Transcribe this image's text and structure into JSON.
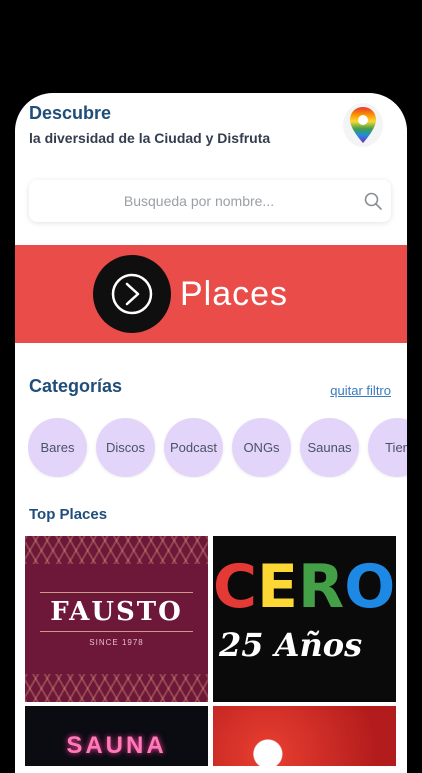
{
  "header": {
    "title": "Descubre",
    "subtitle": "la diversidad de la Ciudad y Disfruta"
  },
  "search": {
    "placeholder": "Busqueda por nombre...",
    "value": ""
  },
  "banner": {
    "label": "Places",
    "color": "#ea4c4a"
  },
  "categories": {
    "title": "Categorías",
    "clear_filter": "quitar filtro",
    "items": [
      "Bares",
      "Discos",
      "Podcast",
      "ONGs",
      "Saunas",
      "Tien"
    ]
  },
  "top_places": {
    "title": "Top Places",
    "cards": [
      {
        "name": "FAUSTO",
        "sub": "SINCE 1978"
      },
      {
        "name": "CERO",
        "sub": "25 Años"
      },
      {
        "name": "SAUNA"
      },
      {}
    ]
  },
  "colors": {
    "heading": "#1f4e79",
    "chip": "#e3d4fa",
    "link": "#3b7bbf"
  }
}
